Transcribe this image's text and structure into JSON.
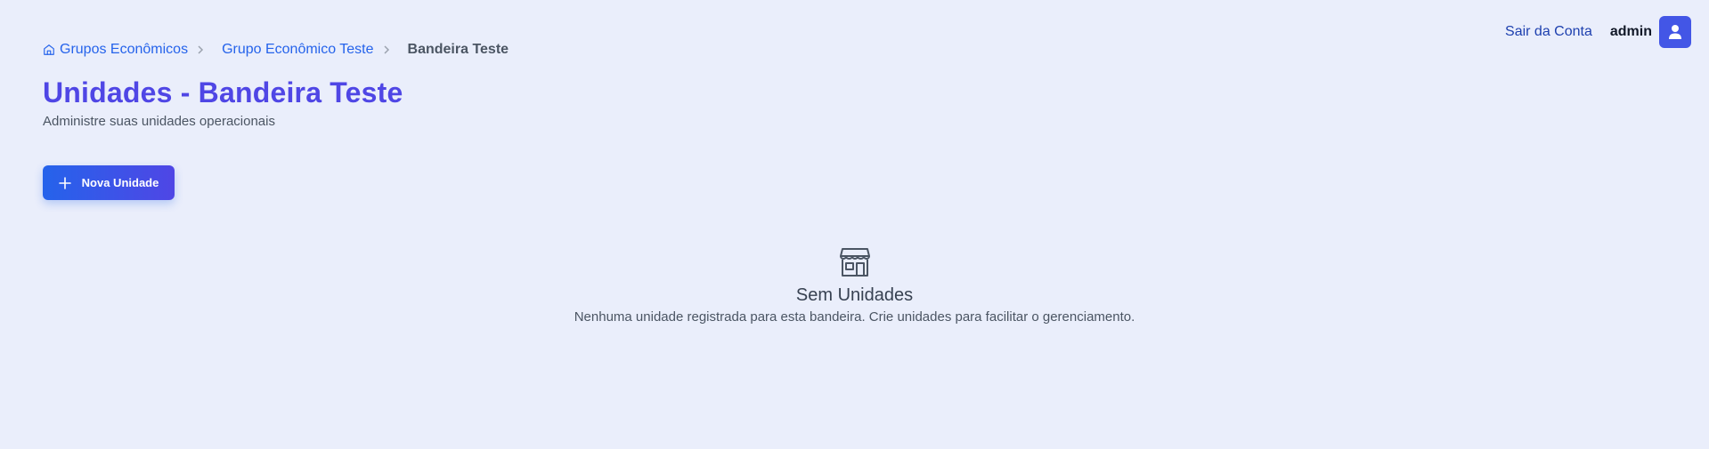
{
  "header": {
    "logout_label": "Sair da Conta",
    "username": "admin",
    "avatar_icon": "user-icon"
  },
  "breadcrumb": {
    "items": [
      {
        "label": "Grupos Econômicos",
        "icon": "home-icon"
      },
      {
        "label": "Grupo Econômico Teste"
      },
      {
        "label": "Bandeira Teste"
      }
    ]
  },
  "page": {
    "title": "Unidades - Bandeira Teste",
    "subtitle": "Administre suas unidades operacionais"
  },
  "actions": {
    "new_unit_label": "Nova Unidade",
    "new_unit_icon": "plus-icon"
  },
  "empty_state": {
    "icon": "store-icon",
    "title": "Sem Unidades",
    "message": "Nenhuma unidade registrada para esta bandeira. Crie unidades para facilitar o gerenciamento."
  },
  "colors": {
    "background": "#eaeefb",
    "title": "#4f46e5",
    "link": "#2563eb",
    "avatar": "#4356e6"
  }
}
